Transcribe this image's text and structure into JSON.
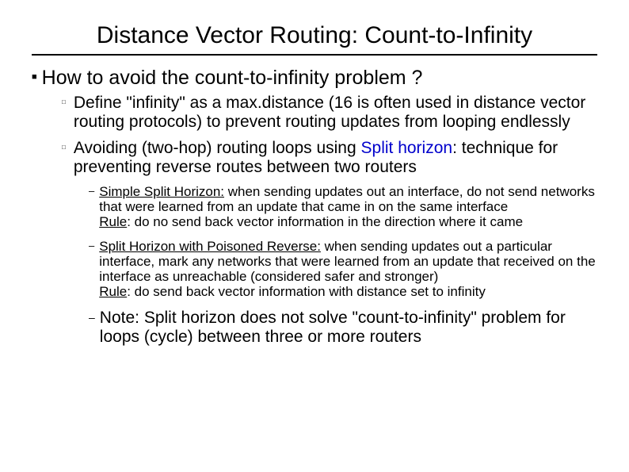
{
  "title": "Distance Vector Routing: Count-to-Infinity",
  "l1": {
    "bullet": "■",
    "text": "How to avoid the count-to-infinity problem ?"
  },
  "l2a": {
    "bullet": "□",
    "text": "Define \"infinity\" as a max.distance (16 is often used in distance vector routing protocols) to prevent routing updates from looping endlessly"
  },
  "l2b": {
    "bullet": "□",
    "pre": "Avoiding (two-hop) routing loops using ",
    "link": "Split horizon",
    "post": ": technique for preventing reverse routes between two routers"
  },
  "l3a": {
    "bullet": "–",
    "label": "Simple Split Horizon:",
    "body": " when sending updates out an interface, do not send networks that were learned from an update that came in on the same interface",
    "rule_label": "Rule",
    "rule_body": ": do no send back vector information in the direction where it came"
  },
  "l3b": {
    "bullet": "–",
    "label": "Split Horizon with Poisoned Reverse:",
    "body": " when sending updates out a particular interface, mark any networks that were learned from an update that received on the interface as unreachable (considered safer and stronger)",
    "rule_label": "Rule",
    "rule_body": ": do send back vector information with distance set to infinity"
  },
  "l3c": {
    "bullet": "–",
    "label": "Note: ",
    "body": "Split horizon does not solve \"count-to-infinity\" problem for loops (cycle) between three or more routers"
  }
}
